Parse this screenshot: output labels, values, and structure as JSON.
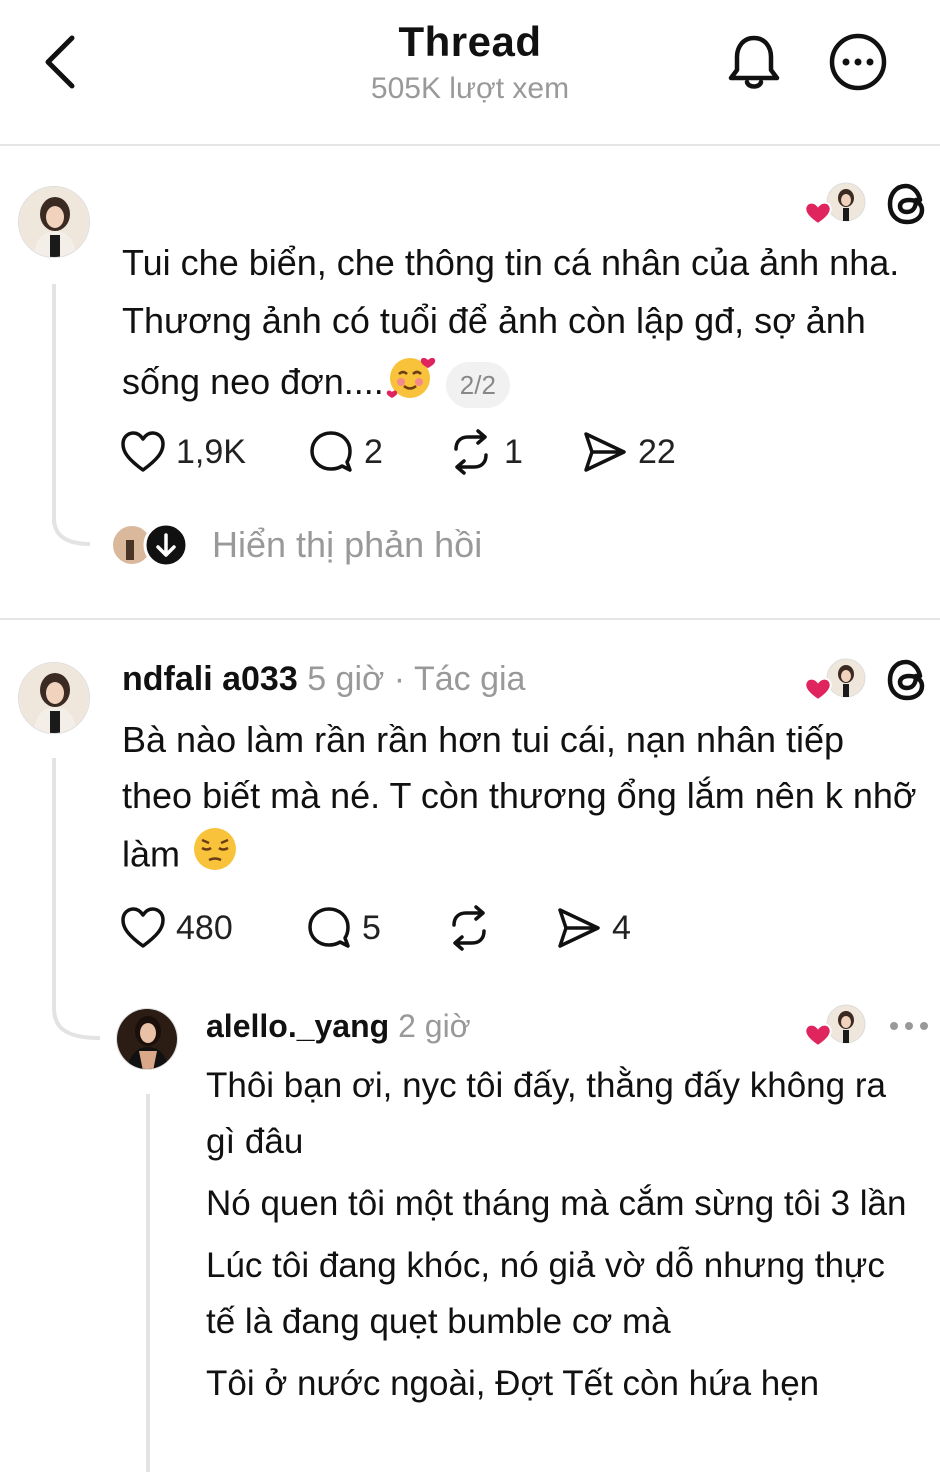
{
  "header": {
    "title": "Thread",
    "views": "505K lượt xem"
  },
  "post1": {
    "text": "Tui che biển, che thông tin cá nhân của ảnh nha. Thương ảnh  có tuổi để ảnh còn lập gđ, sợ ảnh sống neo đơn....",
    "page_indicator": "2/2",
    "likes": "1,9K",
    "comments": "2",
    "reposts": "1",
    "shares": "22",
    "show_replies": "Hiển thị phản hồi"
  },
  "post2": {
    "username": "ndfali a033",
    "time": "5 giờ",
    "separator": "·",
    "author_tag": "Tác gia",
    "text": "Bà nào làm rần rần hơn tui cái, nạn nhân tiếp theo biết mà né. T còn thương ổng lắm nên k nhỡ làm",
    "likes": "480",
    "comments": "5",
    "shares": "4"
  },
  "reply": {
    "username": "alello._yang",
    "time": "2 giờ",
    "paragraphs": [
      "Thôi bạn ơi, nyc tôi đấy, thằng đấy không ra gì đâu",
      "Nó quen tôi một tháng mà cắm sừng tôi 3 lần",
      "Lúc tôi đang khóc, nó giả vờ dỗ nhưng thực tế là đang quẹt bumble cơ mà",
      "Tôi ở nước ngoài, Đợt Tết còn hứa hẹn"
    ]
  },
  "icons": {
    "back": "chevron-left-icon",
    "bell": "bell-icon",
    "more": "more-horizontal-icon",
    "like": "heart-icon",
    "comment": "comment-icon",
    "repost": "repost-icon",
    "share": "send-icon",
    "threads": "threads-logo-icon"
  },
  "colors": {
    "heart_red": "#e0245e",
    "muted_text": "#999999",
    "divider": "#e6e6e6"
  }
}
